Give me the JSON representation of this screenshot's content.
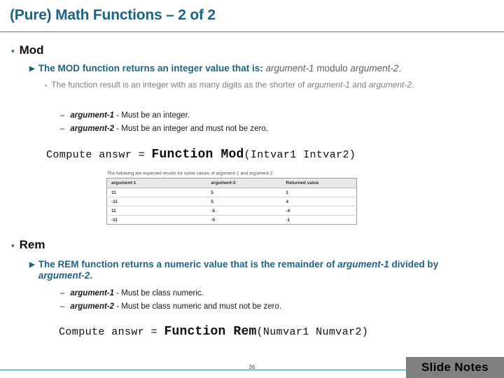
{
  "slide": {
    "title": "(Pure) Math Functions – 2 of 2",
    "page_number": "36",
    "notes_button": "Slide Notes",
    "accent_color": "#1b6389",
    "rule_color": "#2d7fa6",
    "notes_bg_color": "#808080"
  },
  "bullets": {
    "mod_marker": "▪",
    "arrow_marker": "▶",
    "square_marker": "▪",
    "dash_marker": "–"
  },
  "mod": {
    "heading": "Mod",
    "lead_bold": "The MOD function returns an integer value that is:",
    "lead_italic_1": "argument-1",
    "lead_mid": " modulo ",
    "lead_italic_2": "argument-2",
    "lead_end": ".",
    "detail_a": "The function result is an integer with as many digits as the shorter of ",
    "detail_a_i1": "argument-1",
    "detail_a_mid": " and ",
    "detail_a_i2": "argument-2",
    "detail_a_end": ".",
    "arg1_name": "argument-1",
    "arg1_desc": " - Must be an integer.",
    "arg2_name": "argument-2",
    "arg2_desc": " - Must be an integer and must not be zero.",
    "code_pre": "Compute answr = ",
    "code_fn": "Function Mod",
    "code_post": "(Intvar1 Intvar2)"
  },
  "rem": {
    "heading": "Rem",
    "lead_bold_1": "The REM function returns a numeric value that is the remainder of ",
    "lead_italic_1": "argument-1",
    "lead_bold_2": " divided by ",
    "lead_italic_2": "argument-2",
    "lead_end": ".",
    "arg1_name": "argument-1",
    "arg1_desc": " - Must be class numeric.",
    "arg2_name": "argument-2",
    "arg2_desc": " - Must be class numeric and must not be zero.",
    "code_pre": "Compute answr = ",
    "code_fn": "Function Rem",
    "code_post": "(Numvar1 Numvar2)"
  },
  "table_image": {
    "caption": "The following are expected results for some values of argument-1 and argument-2.",
    "headers": [
      "argument-1",
      "argument-2",
      "Returned value"
    ],
    "rows": [
      [
        "11",
        "5",
        "1"
      ],
      [
        "-11",
        "5",
        "4"
      ],
      [
        "11",
        "-5",
        "-4"
      ],
      [
        "-11",
        "-5",
        "-1"
      ]
    ]
  }
}
